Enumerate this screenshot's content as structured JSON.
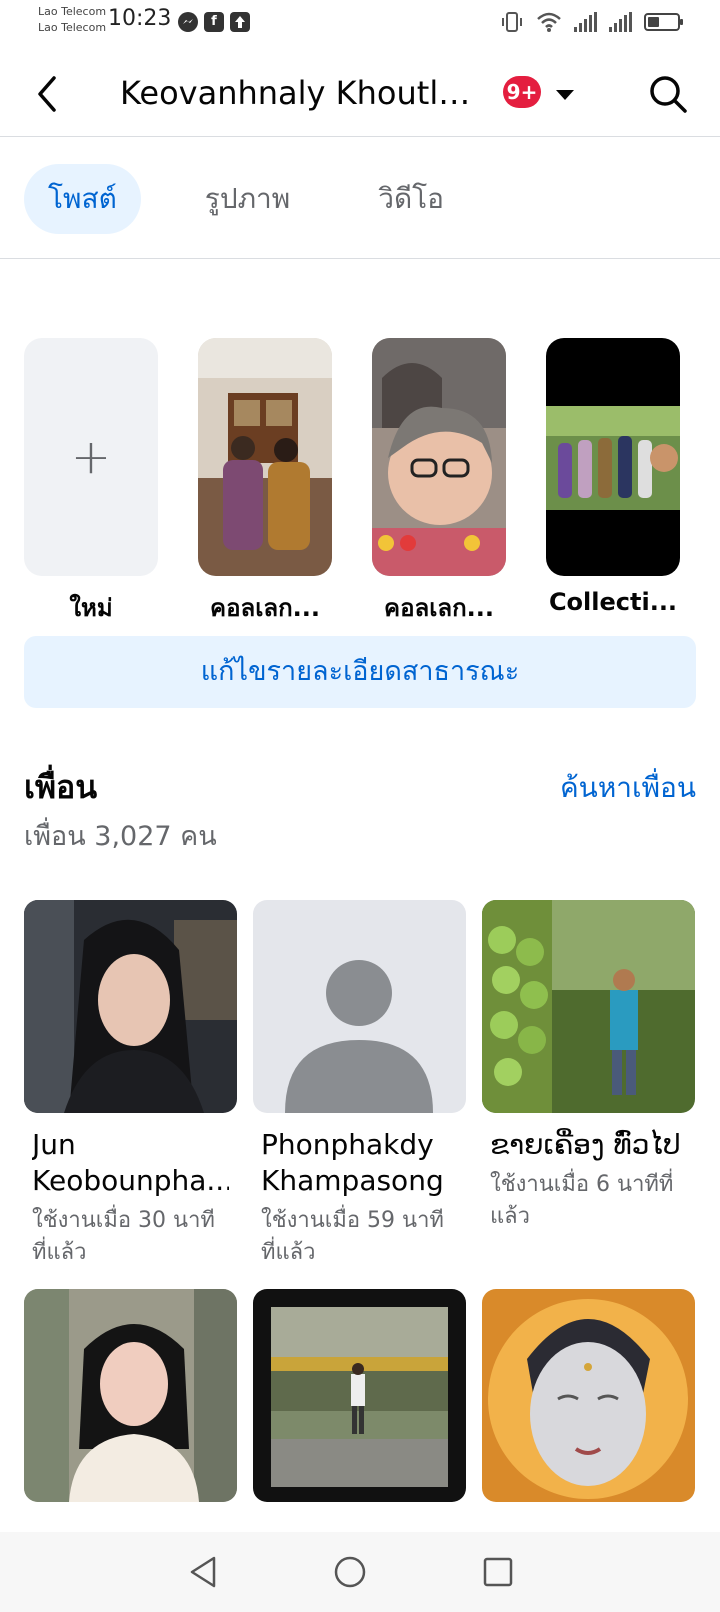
{
  "status_bar": {
    "carrier_1": "Lao Telecom",
    "carrier_2": "Lao Telecom",
    "time": "10:23",
    "battery_level": 0.4,
    "icons": [
      "messenger-icon",
      "facebook-icon",
      "upload-icon",
      "vibrate-icon",
      "wifi-icon",
      "signal-icon",
      "signal-icon",
      "battery-icon"
    ]
  },
  "header": {
    "title": "Keovanhnaly Khoutla...",
    "notification_badge": "9+"
  },
  "tabs": [
    {
      "label": "โพสต์",
      "active": true
    },
    {
      "label": "รูปภาพ",
      "active": false
    },
    {
      "label": "วิดีโอ",
      "active": false
    }
  ],
  "collections": [
    {
      "label": "ใหม่"
    },
    {
      "label": "คอลเลก..."
    },
    {
      "label": "คอลเลก..."
    },
    {
      "label": "Collecti..."
    }
  ],
  "edit_details_button": "แก้ไขรายละเอียดสาธารณะ",
  "friends": {
    "title": "เพื่อน",
    "find_friends": "ค้นหาเพื่อน",
    "count_text": "เพื่อน 3,027 คน",
    "items": [
      {
        "name": "Jun Keobounpha...",
        "active": "ใช้งานเมื่อ 30 นาทีที่แล้ว"
      },
      {
        "name": "Phonphakdy Khampasong",
        "active": "ใช้งานเมื่อ 59 นาทีที่แล้ว"
      },
      {
        "name": "ຂາຍເຄື່ອງ ທົ່ວໄປ",
        "active": "ใช้งานเมื่อ 6 นาทีที่แล้ว"
      },
      {
        "name": "",
        "active": ""
      },
      {
        "name": "",
        "active": ""
      },
      {
        "name": "",
        "active": ""
      }
    ]
  },
  "colors": {
    "accent": "#0064d1",
    "accent_bg": "#e7f3ff",
    "badge": "#e41e3f",
    "secondary_text": "#65676b"
  }
}
